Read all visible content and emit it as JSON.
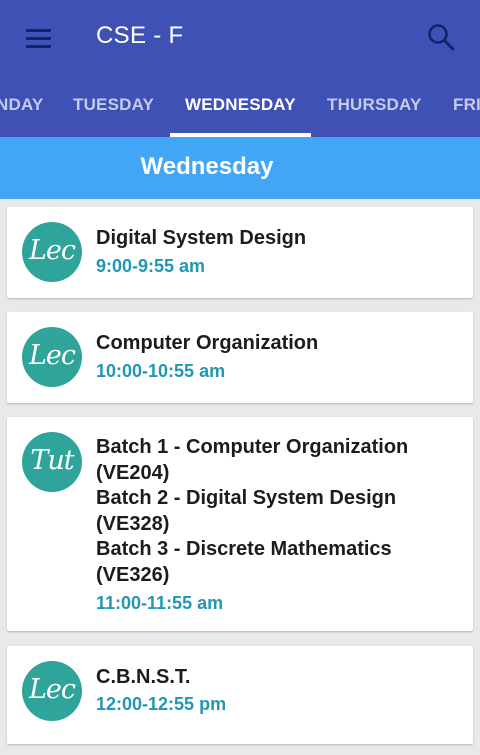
{
  "appbar": {
    "title": "CSE - F",
    "menu_icon": "hamburger-menu-icon",
    "search_icon": "search-icon"
  },
  "tabs": [
    {
      "label": "NDAY"
    },
    {
      "label": "TUESDAY"
    },
    {
      "label": "WEDNESDAY",
      "active": true
    },
    {
      "label": "THURSDAY"
    },
    {
      "label": "FRI"
    }
  ],
  "day_header": "Wednesday",
  "classes": [
    {
      "badge": "Lec",
      "subject": [
        "Digital System Design"
      ],
      "time": "9:00-9:55 am"
    },
    {
      "badge": "Lec",
      "subject": [
        "Computer Organization"
      ],
      "time": "10:00-10:55 am"
    },
    {
      "badge": "Tut",
      "subject": [
        "Batch 1 - Computer Organization",
        "(VE204)",
        "Batch 2 - Digital System Design",
        "(VE328)",
        "Batch 3 - Discrete Mathematics",
        "(VE326)"
      ],
      "time": "11:00-11:55 am"
    },
    {
      "badge": "Lec",
      "subject": [
        "C.B.N.S.T."
      ],
      "time": "12:00-12:55 pm"
    }
  ],
  "colors": {
    "appbar": "#3f51b5",
    "day_header": "#42a5f5",
    "badge": "#2ea49a",
    "time_text": "#2296b3"
  }
}
